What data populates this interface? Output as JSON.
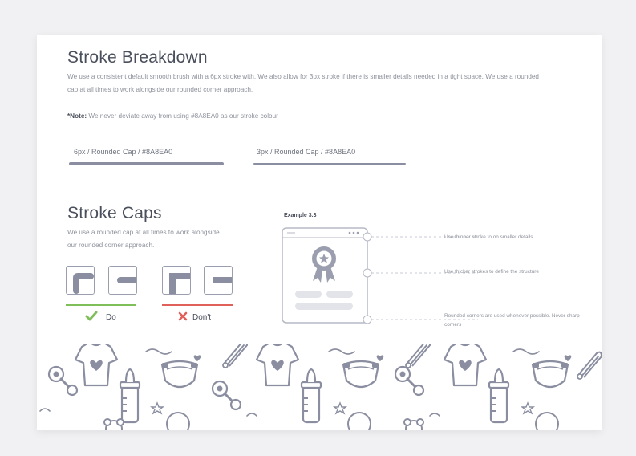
{
  "breakdown": {
    "title": "Stroke Breakdown",
    "description": "We use a consistent default smooth brush with a 6px stroke with. We also allow for 3px stroke if there is smaller details needed  in a tight space. We use a rounded cap at all times to work alongside our rounded corner approach.",
    "note_label": "*Note:",
    "note_text": " We never deviate away from using #8A8EA0 as our stroke colour",
    "spec_thick": "6px / Rounded Cap / #8A8EA0",
    "spec_thin": "3px / Rounded Cap / #8A8EA0"
  },
  "caps": {
    "title": "Stroke Caps",
    "description": "We use a rounded cap at all times to work alongside our rounded corner approach.",
    "do_label": "Do",
    "dont_label": "Don't"
  },
  "example": {
    "title": "Example 3.3",
    "callouts": [
      "Use thinner stroke to on smaller details",
      "Use thicker strokes to define the structure",
      "Rounded corners are used whenever possible. Never sharp corners"
    ]
  },
  "colors": {
    "stroke": "#8A8EA0",
    "do_green": "#7fbf5a",
    "dont_red": "#e0605a",
    "title_gray": "#4a4f5c",
    "card_bg": "#ffffff",
    "page_bg": "#f1f1f3"
  },
  "icons": [
    "checkmark-icon",
    "cross-icon",
    "award-badge-icon",
    "window-dots-icon",
    "baby-onesie-icon",
    "baby-bottle-icon",
    "diaper-icon",
    "pacifier-icon",
    "safety-pin-icon",
    "heart-icon",
    "star-icon"
  ]
}
